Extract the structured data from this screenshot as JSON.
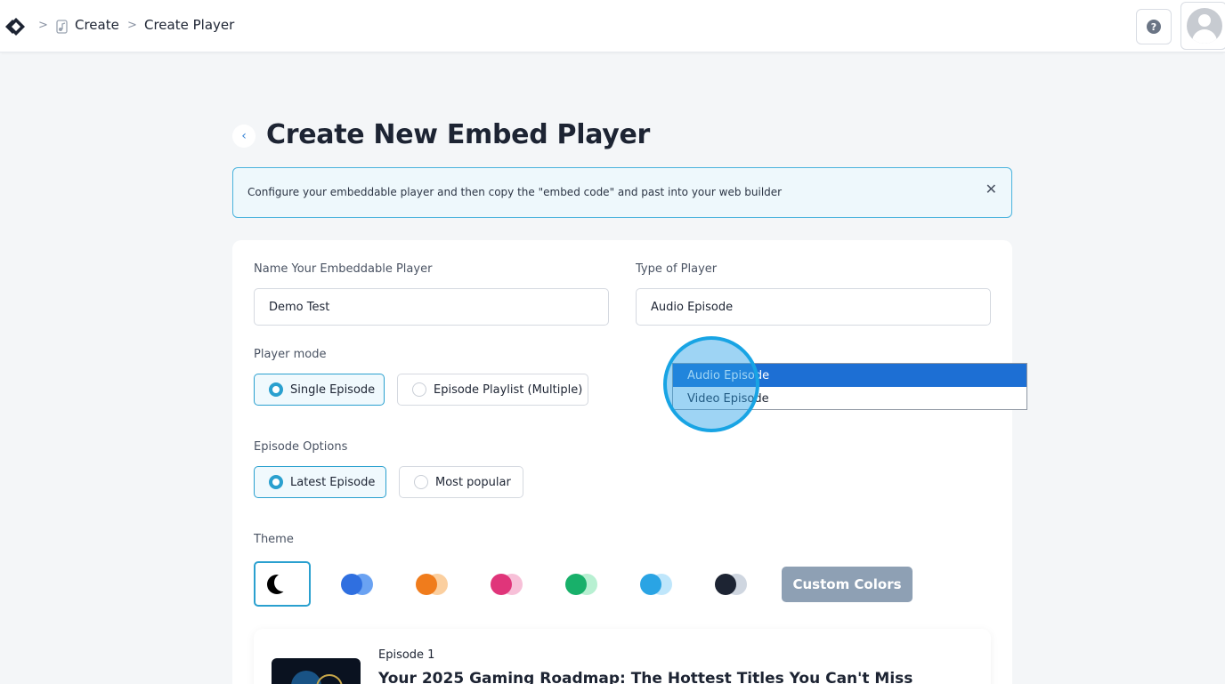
{
  "breadcrumb": {
    "logo_icon": "app-logo-icon",
    "items": [
      {
        "label": "Create",
        "icon": "music-file-icon"
      },
      {
        "label": "Create Player"
      }
    ]
  },
  "header": {
    "help_icon": "question-circle-icon",
    "help_symbol": "?",
    "avatar_icon": "user-avatar-icon"
  },
  "page": {
    "title": "Create New Embed Player",
    "back_symbol": "‹"
  },
  "alert": {
    "text": "Configure your embeddable player and then copy the \"embed code\" and past into your web builder",
    "close_symbol": "✕"
  },
  "form": {
    "name": {
      "label": "Name Your Embeddable Player",
      "value": "Demo Test"
    },
    "type": {
      "label": "Type of Player",
      "value": "Audio Episode"
    },
    "player_mode": {
      "label": "Player mode",
      "options": [
        {
          "label": "Single Episode",
          "selected": true
        },
        {
          "label": "Episode Playlist (Multiple)",
          "selected": false
        }
      ]
    },
    "episode_options": {
      "label": "Episode Options",
      "options": [
        {
          "label": "Latest Episode",
          "selected": true
        },
        {
          "label": "Most popular",
          "selected": false
        }
      ]
    },
    "theme": {
      "label": "Theme",
      "swatches": [
        {
          "name": "dark",
          "colors": [
            "#000000",
            "#ffffff"
          ],
          "selected": true
        },
        {
          "name": "blue",
          "colors": [
            "#2f6fe0",
            "#6aa2f2"
          ]
        },
        {
          "name": "orange",
          "colors": [
            "#f07c1c",
            "#fbcf9f"
          ]
        },
        {
          "name": "pink",
          "colors": [
            "#e0357a",
            "#f7c0d8"
          ]
        },
        {
          "name": "green",
          "colors": [
            "#18b06a",
            "#b8f0d2"
          ]
        },
        {
          "name": "sky",
          "colors": [
            "#2aa4e4",
            "#bfe6fb"
          ]
        },
        {
          "name": "slate",
          "colors": [
            "#1d2433",
            "#cfd6e0"
          ]
        }
      ],
      "custom_label": "Custom Colors"
    }
  },
  "preview": {
    "episode_label": "Episode 1",
    "episode_title": "Your 2025 Gaming Roadmap: The Hottest Titles You Can't Miss"
  },
  "dropdown": {
    "options": [
      {
        "label": "Audio Episode",
        "highlighted": true
      },
      {
        "label": "Video Episode",
        "highlighted": false
      }
    ]
  },
  "colors": {
    "accent": "#2aa0cf",
    "dropdown_highlight": "#1d6fd4",
    "custom_button": "#8ea0b4"
  }
}
